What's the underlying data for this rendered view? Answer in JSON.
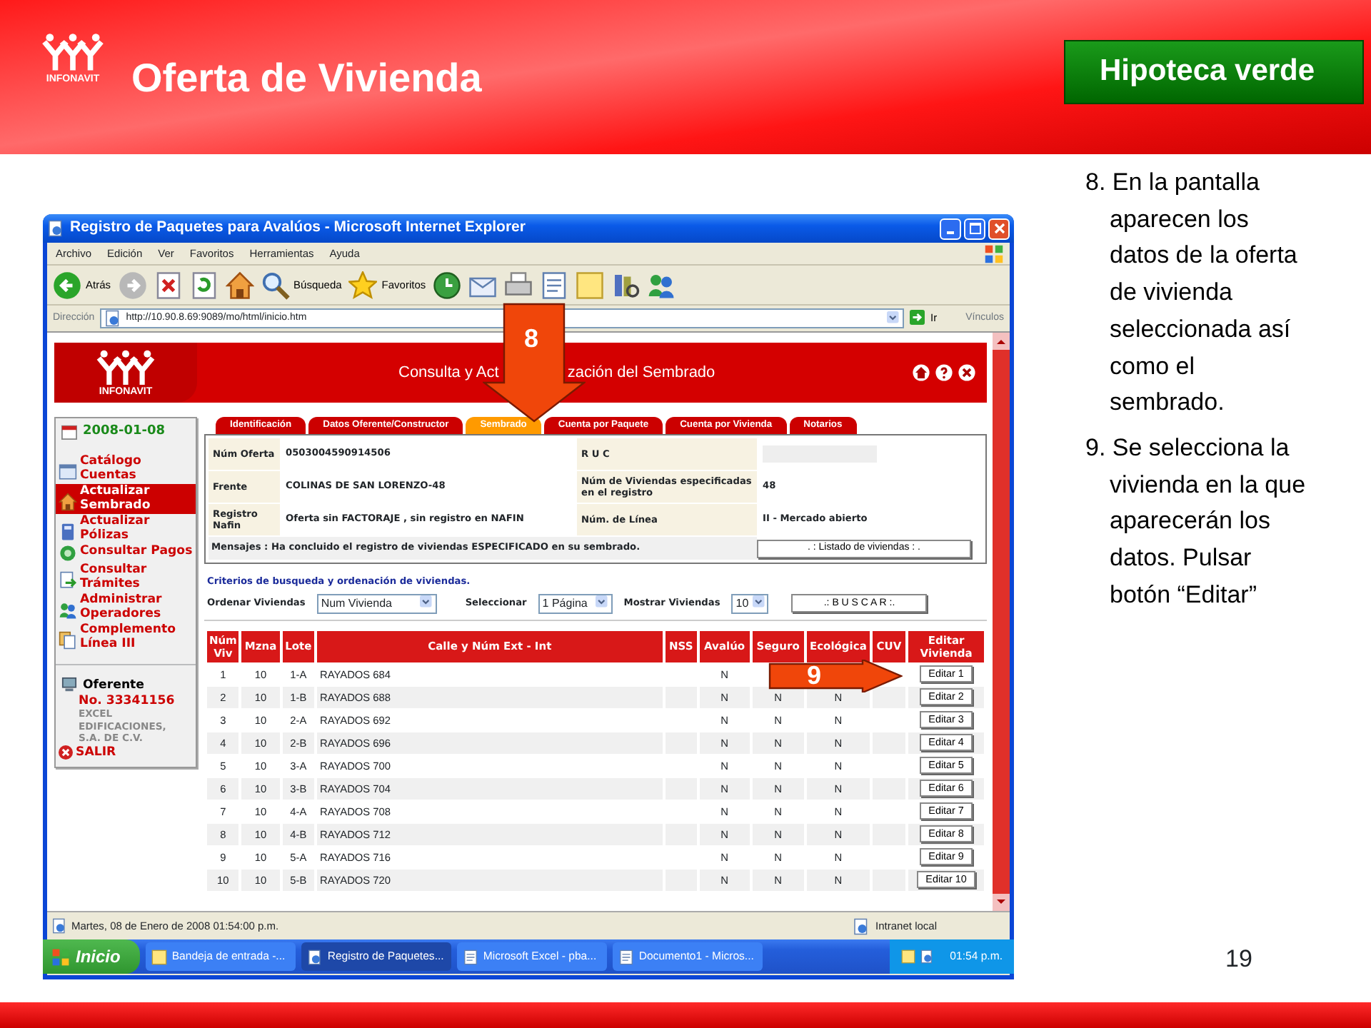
{
  "slide": {
    "logo_text": "INFONAVIT",
    "title": "Oferta de Vivienda",
    "badge": "Hipoteca verde",
    "page_number": "19",
    "notes": [
      "8. En la pantalla aparecen los datos de la oferta de vivienda seleccionada así como el sembrado.",
      "9. Se selecciona la vivienda en la que aparecerán los datos. Pulsar botón “Editar”"
    ],
    "callouts": [
      "8",
      "9"
    ]
  },
  "window": {
    "title": "Registro de Paquetes para Avalúos - Microsoft Internet Explorer",
    "menu": [
      "Archivo",
      "Edición",
      "Ver",
      "Favoritos",
      "Herramientas",
      "Ayuda"
    ],
    "toolbar": {
      "back": "Atrás",
      "search": "Búsqueda",
      "favorites": "Favoritos"
    },
    "address_label": "Dirección",
    "address": "http://10.90.8.69:9089/mo/html/inicio.htm",
    "go": "Ir",
    "links": "Vínculos",
    "status": "Martes, 08 de Enero de 2008 01:54:00 p.m.",
    "zone": "Intranet local"
  },
  "page": {
    "logo_text": "INFONAVIT",
    "title_parts": [
      "Consulta y Act",
      "zación del Sembrado"
    ],
    "date": "2008-01-08",
    "sidebar": [
      {
        "lines": [
          "Catálogo",
          "Cuentas"
        ],
        "selected": false
      },
      {
        "lines": [
          "Actualizar",
          "Sembrado"
        ],
        "selected": true
      },
      {
        "lines": [
          "Actualizar",
          "Pólizas"
        ],
        "selected": false
      },
      {
        "lines": [
          "Consultar Pagos"
        ],
        "selected": false
      },
      {
        "lines": [
          "Consultar",
          "Trámites"
        ],
        "selected": false
      },
      {
        "lines": [
          "Administrar",
          "Operadores"
        ],
        "selected": false
      },
      {
        "lines": [
          "Complemento",
          "Línea III"
        ],
        "selected": false
      }
    ],
    "oferente": {
      "label": "Oferente",
      "number": "No. 33341156",
      "name_lines": [
        "EXCEL",
        "EDIFICACIONES,",
        "S.A. DE C.V."
      ]
    },
    "logout": "SALIR",
    "tabs": [
      {
        "label": "Identificación",
        "selected": false
      },
      {
        "label": "Datos Oferente/Constructor",
        "selected": false
      },
      {
        "label": "Sembrado",
        "selected": true
      },
      {
        "label": "Cuenta por Paquete",
        "selected": false
      },
      {
        "label": "Cuenta por Vivienda",
        "selected": false
      },
      {
        "label": "Notarios",
        "selected": false
      }
    ],
    "info_left": [
      {
        "label": "Núm Oferta",
        "value": "0503004590914506"
      },
      {
        "label": "Frente",
        "value": "COLINAS DE SAN LORENZO-48"
      },
      {
        "label": "Registro Nafin",
        "value": "Oferta sin FACTORAJE , sin registro en NAFIN"
      }
    ],
    "info_right": [
      {
        "label": "R U C"
      },
      {
        "label": "Núm de Viviendas especificadas en el registro",
        "value": "48"
      },
      {
        "label": "Núm. de Línea",
        "value": "II - Mercado abierto"
      }
    ],
    "message": "Mensajes : Ha concluido el registro de viviendas ESPECIFICADO en su sembrado.",
    "list_button": ". : Listado de viviendas : .",
    "criteria_title": "Criterios de busqueda y ordenación de viviendas.",
    "order_label": "Ordenar Viviendas",
    "order_value": "Num Vivienda",
    "select_label": "Seleccionar",
    "select_value": "1 Página",
    "show_label": "Mostrar Viviendas",
    "show_value": "10",
    "search_button": ".: B U S C A R :.",
    "table": {
      "columns": [
        "Núm Viv",
        "Mzna",
        "Lote",
        "Calle y Núm Ext - Int",
        "NSS",
        "Avalúo",
        "Seguro",
        "Ecológica",
        "CUV",
        "Editar Vivienda"
      ],
      "rows": [
        {
          "num": "1",
          "mzna": "10",
          "lote": "1-A",
          "calle": "RAYADOS 684",
          "avaluo": "N",
          "button": "Editar 1"
        },
        {
          "num": "2",
          "mzna": "10",
          "lote": "1-B",
          "calle": "RAYADOS 688",
          "avaluo": "N",
          "seguro": "N",
          "ecologica": "N",
          "button": "Editar 2"
        },
        {
          "num": "3",
          "mzna": "10",
          "lote": "2-A",
          "calle": "RAYADOS 692",
          "avaluo": "N",
          "seguro": "N",
          "ecologica": "N",
          "button": "Editar 3"
        },
        {
          "num": "4",
          "mzna": "10",
          "lote": "2-B",
          "calle": "RAYADOS 696",
          "avaluo": "N",
          "seguro": "N",
          "ecologica": "N",
          "button": "Editar 4"
        },
        {
          "num": "5",
          "mzna": "10",
          "lote": "3-A",
          "calle": "RAYADOS 700",
          "avaluo": "N",
          "seguro": "N",
          "ecologica": "N",
          "button": "Editar 5"
        },
        {
          "num": "6",
          "mzna": "10",
          "lote": "3-B",
          "calle": "RAYADOS 704",
          "avaluo": "N",
          "seguro": "N",
          "ecologica": "N",
          "button": "Editar 6"
        },
        {
          "num": "7",
          "mzna": "10",
          "lote": "4-A",
          "calle": "RAYADOS 708",
          "avaluo": "N",
          "seguro": "N",
          "ecologica": "N",
          "button": "Editar 7"
        },
        {
          "num": "8",
          "mzna": "10",
          "lote": "4-B",
          "calle": "RAYADOS 712",
          "avaluo": "N",
          "seguro": "N",
          "ecologica": "N",
          "button": "Editar 8"
        },
        {
          "num": "9",
          "mzna": "10",
          "lote": "5-A",
          "calle": "RAYADOS 716",
          "avaluo": "N",
          "seguro": "N",
          "ecologica": "N",
          "button": "Editar 9"
        },
        {
          "num": "10",
          "mzna": "10",
          "lote": "5-B",
          "calle": "RAYADOS 720",
          "avaluo": "N",
          "seguro": "N",
          "ecologica": "N",
          "button": "Editar 10"
        }
      ]
    }
  },
  "taskbar": {
    "start": "Inicio",
    "items": [
      {
        "label": "Bandeja de entrada -...",
        "selected": false
      },
      {
        "label": "Registro de Paquetes...",
        "selected": true
      },
      {
        "label": "Microsoft Excel - pba...",
        "selected": false
      },
      {
        "label": "Documento1 - Micros...",
        "selected": false
      }
    ],
    "clock": "01:54 p.m."
  }
}
